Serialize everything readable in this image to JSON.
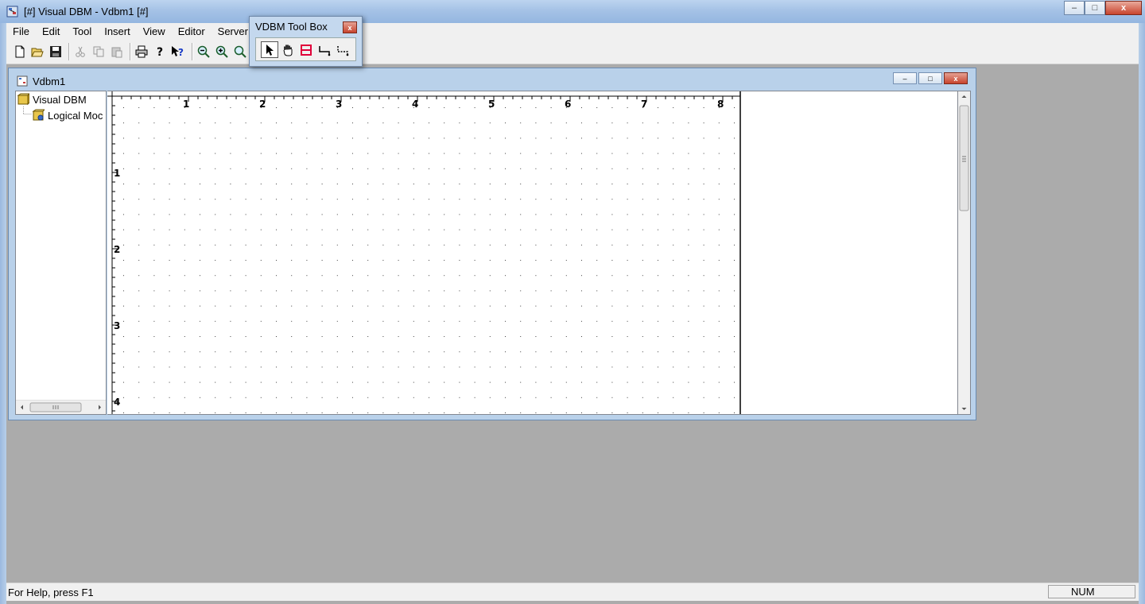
{
  "window": {
    "title": "[#] Visual DBM - Vdbm1 [#]",
    "minimize": "–",
    "maximize": "□",
    "close": "x"
  },
  "menu": [
    "File",
    "Edit",
    "Tool",
    "Insert",
    "View",
    "Editor",
    "Server"
  ],
  "toolbar": {
    "buttons": [
      "new-doc",
      "open-folder",
      "save",
      "cut",
      "copy",
      "paste",
      "print",
      "help",
      "context-help",
      "zoom-out",
      "zoom-in",
      "zoom-fit"
    ]
  },
  "toolbox": {
    "title": "VDBM Tool Box",
    "close": "x",
    "tools": [
      "pointer",
      "hand",
      "entity",
      "relation",
      "dashed-relation"
    ]
  },
  "child_window": {
    "title": "Vdbm1",
    "tree": {
      "root": "Visual DBM",
      "child": "Logical Moc"
    },
    "ruler": {
      "top_labels": [
        "1",
        "2",
        "3",
        "4",
        "5",
        "6",
        "7",
        "8"
      ],
      "left_labels": [
        "1",
        "2",
        "3",
        "4"
      ]
    }
  },
  "statusbar": {
    "help": "For Help, press F1",
    "num": "NUM"
  },
  "colors": {
    "titlebar": "#a5c2e6",
    "mdi_background": "#ababab",
    "entity_tool": "#e0003a"
  }
}
